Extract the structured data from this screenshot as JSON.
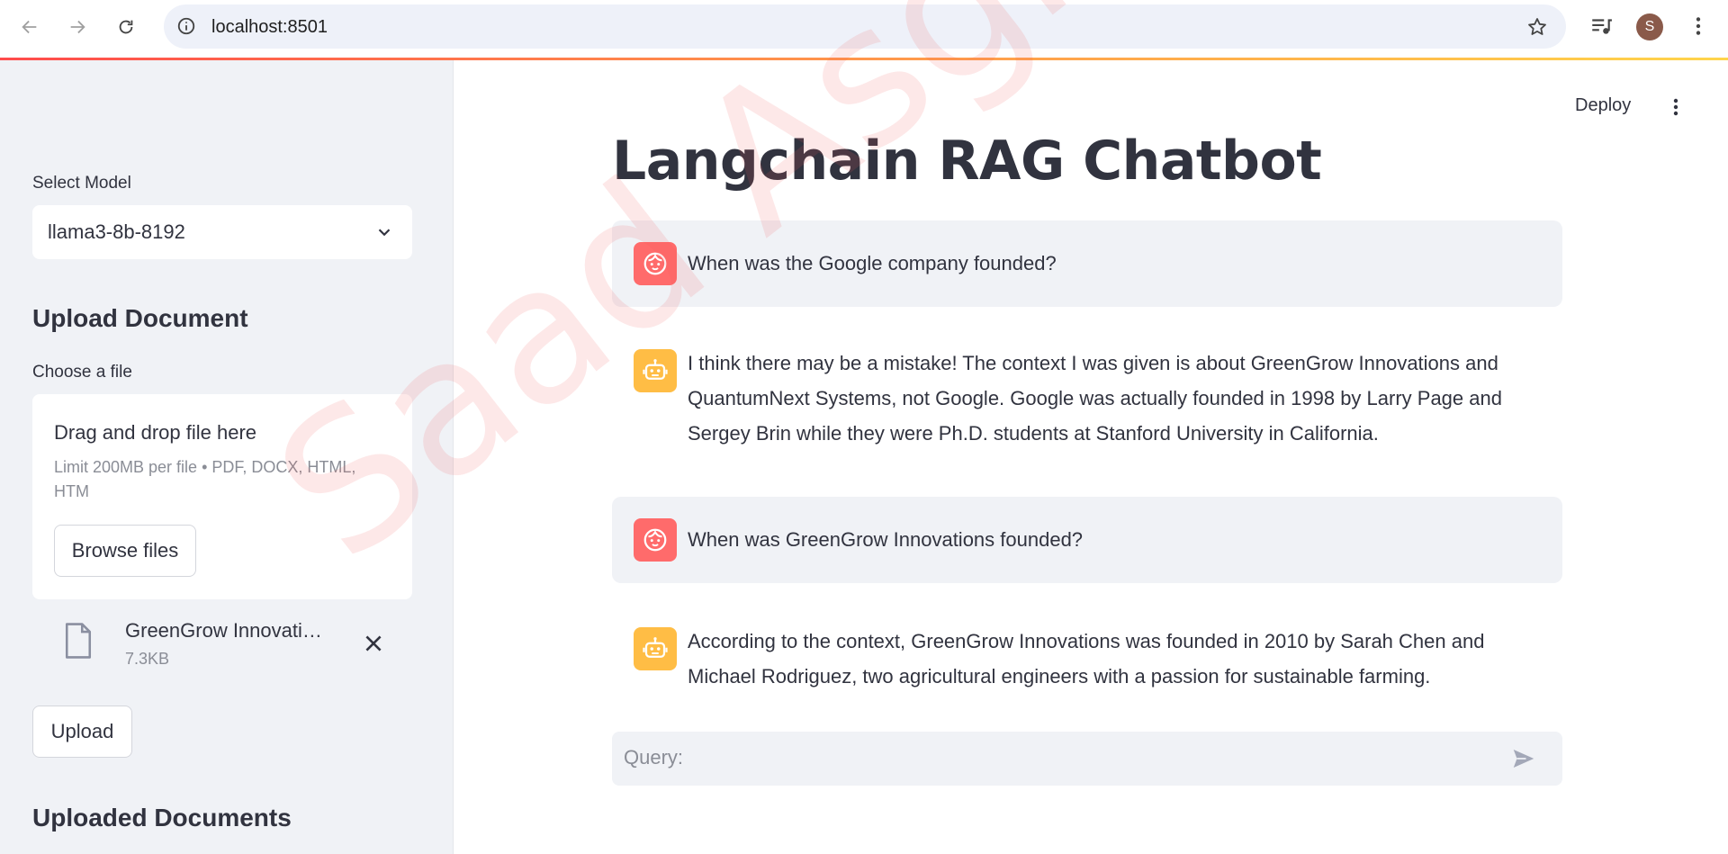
{
  "browser": {
    "url": "localhost:8501",
    "avatar_letter": "S"
  },
  "sidebar": {
    "select_label": "Select Model",
    "select_value": "llama3-8b-8192",
    "upload_heading": "Upload Document",
    "file_label": "Choose a file",
    "dropzone_title": "Drag and drop file here",
    "dropzone_limit": "Limit 200MB per file • PDF, DOCX, HTML, HTM",
    "browse_label": "Browse files",
    "file_name": "GreenGrow Innovations…",
    "file_size": "7.3KB",
    "upload_label": "Upload",
    "uploaded_heading": "Uploaded Documents"
  },
  "main": {
    "deploy_label": "Deploy",
    "title": "Langchain RAG Chatbot",
    "messages": [
      {
        "role": "user",
        "text": "When was the Google company founded?"
      },
      {
        "role": "assistant",
        "text": "I think there may be a mistake! The context I was given is about GreenGrow Innovations and QuantumNext Systems, not Google. Google was actually founded in 1998 by Larry Page and Sergey Brin while they were Ph.D. students at Stanford University in California."
      },
      {
        "role": "user",
        "text": "When was GreenGrow Innovations founded?"
      },
      {
        "role": "assistant",
        "text": "According to the context, GreenGrow Innovations was founded in 2010 by Sarah Chen and Michael Rodriguez, two agricultural engineers with a passion for sustainable farming."
      }
    ],
    "query_placeholder": "Query:"
  },
  "watermark": "Saad Asghar",
  "colors": {
    "user_avatar": "#ff6b6b",
    "assistant_avatar": "#ffbd45",
    "sidebar_bg": "#f0f2f6",
    "accent": "#ff4b4b"
  },
  "icons": {
    "back": "arrow-left-icon",
    "forward": "arrow-right-icon",
    "reload": "reload-icon",
    "info": "info-icon",
    "bookmark": "star-icon",
    "media": "media-controls-icon",
    "menu": "kebab-menu-icon",
    "file": "document-icon",
    "remove": "close-icon",
    "send": "send-icon",
    "user": "user-face-icon",
    "assistant": "robot-icon"
  }
}
